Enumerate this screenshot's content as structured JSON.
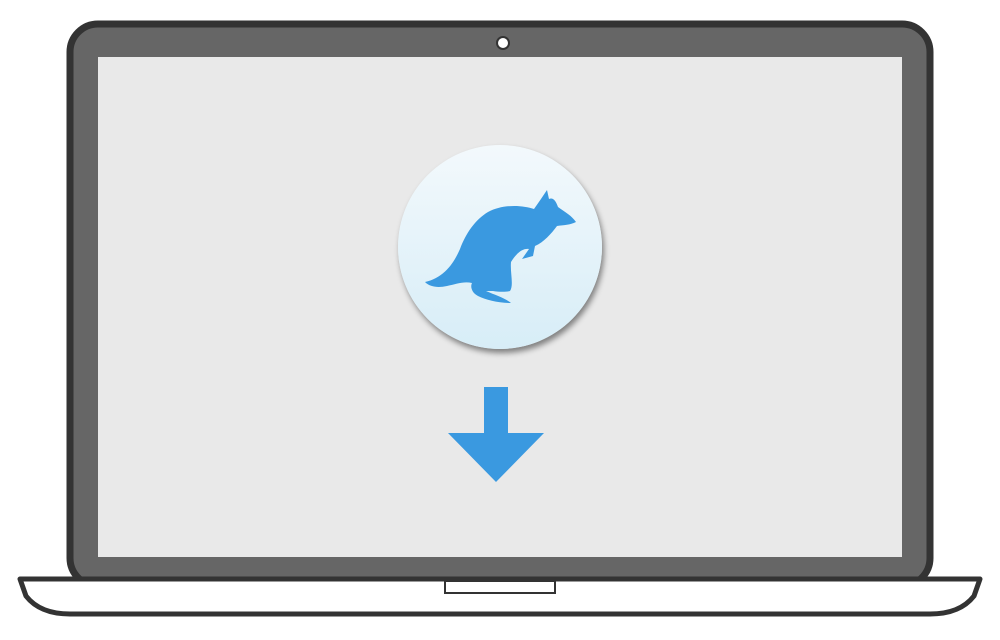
{
  "colors": {
    "bezel": "#666666",
    "frame": "#333333",
    "screen": "#e9e9e9",
    "accent": "#3a99e0",
    "icon_bg_top": "#f3f9fc",
    "icon_bg_bottom": "#d7edf7",
    "base": "#ffffff"
  },
  "icons": {
    "app": "kangaroo-icon",
    "action": "download-arrow-icon",
    "camera": "webcam-icon"
  }
}
